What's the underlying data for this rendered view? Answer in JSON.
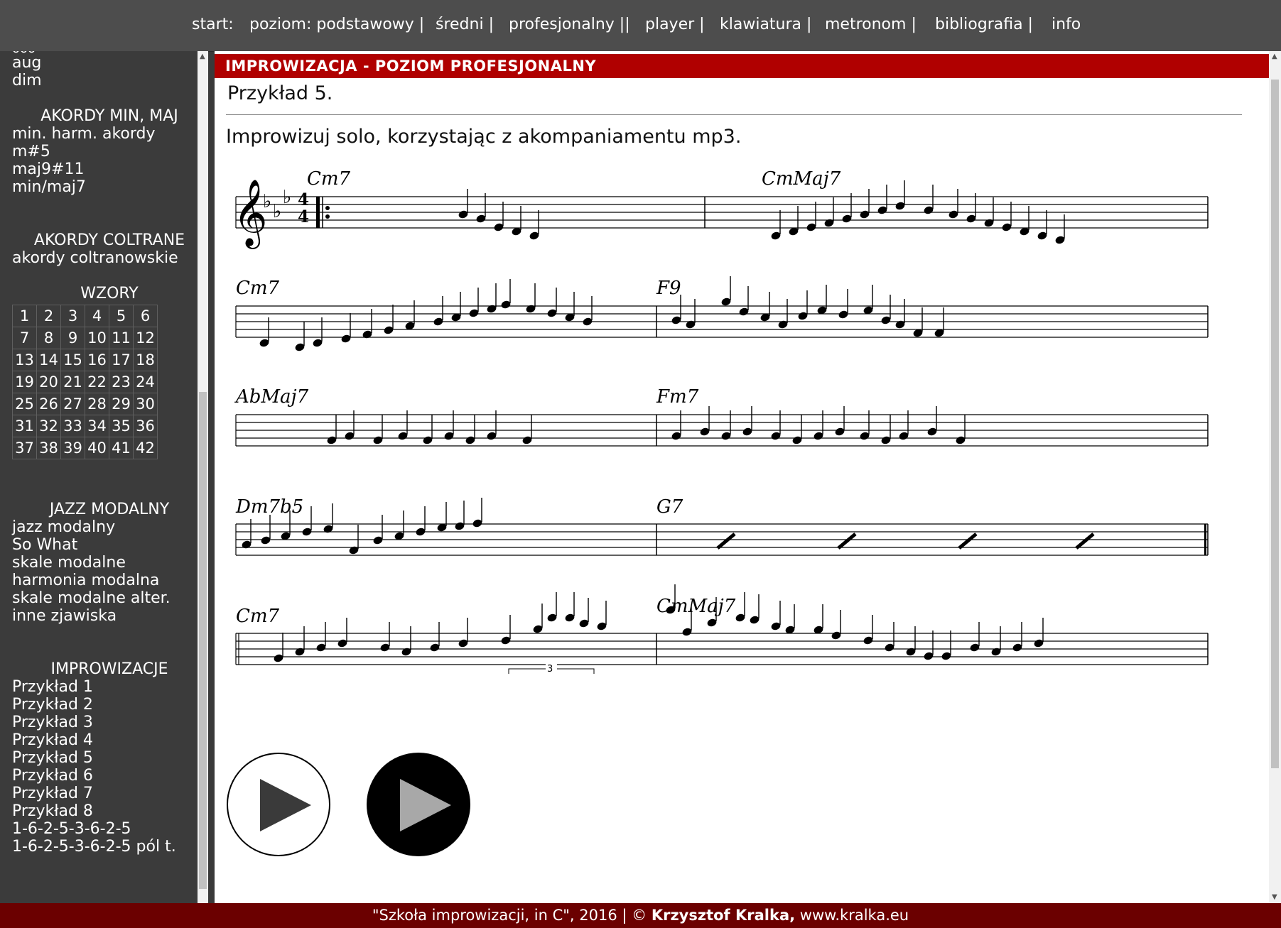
{
  "nav": {
    "start": "start:",
    "poziom": "poziom: podstawowy |",
    "sredni": "średni |",
    "profesjonalny": "profesjonalny ||",
    "player": "player |",
    "klawiatura": "klawiatura |",
    "metronom": "metronom |",
    "bibliografia": "bibliografia |",
    "info": "info"
  },
  "sidebar": {
    "partial_top": "ooo",
    "links_top": [
      "aug",
      "dim"
    ],
    "akordy_min_maj": {
      "heading": "AKORDY MIN, MAJ",
      "links": [
        "min. harm. akordy",
        "m#5",
        "maj9#11",
        "min/maj7"
      ]
    },
    "akordy_coltrane": {
      "heading": "AKORDY COLTRANE",
      "links": [
        "akordy coltranowskie"
      ]
    },
    "wzory": {
      "heading": "WZORY",
      "cells": [
        "1",
        "2",
        "3",
        "4",
        "5",
        "6",
        "7",
        "8",
        "9",
        "10",
        "11",
        "12",
        "13",
        "14",
        "15",
        "16",
        "17",
        "18",
        "19",
        "20",
        "21",
        "22",
        "23",
        "24",
        "25",
        "26",
        "27",
        "28",
        "29",
        "30",
        "31",
        "32",
        "33",
        "34",
        "35",
        "36",
        "37",
        "38",
        "39",
        "40",
        "41",
        "42"
      ]
    },
    "jazz_modalny": {
      "heading": "JAZZ MODALNY",
      "links": [
        "jazz modalny",
        "So What",
        "skale modalne",
        "harmonia modalna",
        "skale modalne alter.",
        "inne zjawiska"
      ]
    },
    "improwizacje": {
      "heading": "IMPROWIZACJE",
      "links": [
        "Przykład 1",
        "Przykład 2",
        "Przykład 3",
        "Przykład 4",
        "Przykład 5",
        "Przykład 6",
        "Przykład 7",
        "Przykład 8",
        "1-6-2-5-3-6-2-5",
        "1-6-2-5-3-6-2-5 pól t."
      ]
    }
  },
  "main": {
    "banner": "IMPROWIZACJA - POZIOM PROFESJONALNY",
    "title": "Przykład 5.",
    "instruction": "Improwizuj solo, korzystając z akompaniamentu mp3.",
    "score": {
      "time_signature": [
        "4",
        "4"
      ],
      "tuplet": "3",
      "chords": [
        "Cm7",
        "CmMaj7",
        "Cm7",
        "F9",
        "AbMaj7",
        "Fm7",
        "Dm7b5",
        "G7",
        "Cm7",
        "CmMaj7"
      ]
    },
    "play_icons": [
      "play-icon",
      "play-icon"
    ]
  },
  "footer": {
    "text": "\"Szkoła improwizacji, in C\", 2016 | © ",
    "author": "Krzysztof Kralka,",
    "site": " www.kralka.eu"
  },
  "colors": {
    "nav_bg": "#4d4d4d",
    "sidebar_bg": "#3b3b3b",
    "banner_bg": "#b00000",
    "footer_bg": "#6b0000"
  }
}
